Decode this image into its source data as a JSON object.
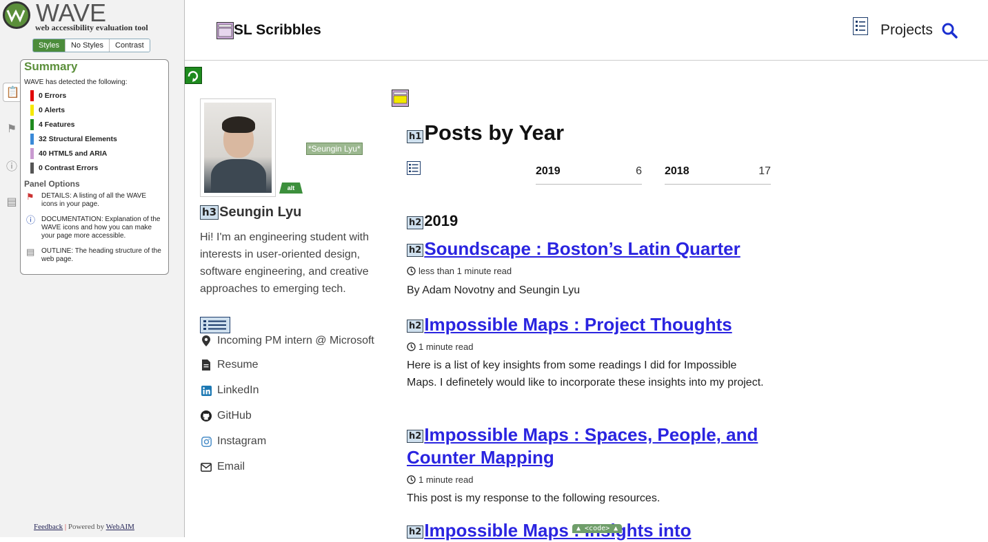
{
  "wave": {
    "title": "WAVE",
    "subtitle": "web accessibility evaluation tool",
    "modes": [
      "Styles",
      "No Styles",
      "Contrast"
    ],
    "summary_title": "Summary",
    "detected_text": "WAVE has detected the following:",
    "stats": [
      {
        "label": "0 Errors",
        "color": "#e00000"
      },
      {
        "label": "0 Alerts",
        "color": "#f5e800"
      },
      {
        "label": "4 Features",
        "color": "#1e8a1e"
      },
      {
        "label": "32 Structural Elements",
        "color": "#3a8ad8"
      },
      {
        "label": "40 HTML5 and ARIA",
        "color": "#c99ad0"
      },
      {
        "label": "0 Contrast Errors",
        "color": "#555555"
      }
    ],
    "panel_options_title": "Panel Options",
    "panel_options": [
      {
        "icon": "flag-icon",
        "text": "DETAILS: A listing of all the WAVE icons in your page."
      },
      {
        "icon": "info-icon",
        "text": "DOCUMENTATION: Explanation of the WAVE icons and how you can make your page more accessible."
      },
      {
        "icon": "document-icon",
        "text": "OUTLINE: The heading structure of the web page."
      }
    ],
    "footer_feedback": "Feedback",
    "footer_sep": "|",
    "footer_powered": "Powered by",
    "footer_webaim": "WebAIM"
  },
  "site": {
    "title": "SL Scribbles",
    "nav_projects": "Projects",
    "accent": "#2a24e0"
  },
  "author": {
    "alt_text": "*Seungin Lyu*",
    "alt_tag": "alt",
    "h3_badge": "h3",
    "name": "Seungin Lyu",
    "bio": "Hi! I'm an engineering student with interests in user-oriented design, software engineering, and creative approaches to emerging tech.",
    "links": [
      {
        "icon": "map-marker-icon",
        "label": "Incoming PM intern @ Microsoft"
      },
      {
        "icon": "file-icon",
        "label": "Resume"
      },
      {
        "icon": "linkedin-icon",
        "label": "LinkedIn"
      },
      {
        "icon": "github-icon",
        "label": "GitHub"
      },
      {
        "icon": "instagram-icon",
        "label": "Instagram"
      },
      {
        "icon": "envelope-icon",
        "label": "Email"
      }
    ]
  },
  "main": {
    "h1_badge": "h1",
    "h2_badge": "h2",
    "heading": "Posts by Year",
    "year_tabs": [
      {
        "year": "2019",
        "count": "6"
      },
      {
        "year": "2018",
        "count": "17"
      }
    ],
    "year_heading": "2019",
    "posts": [
      {
        "title": "Soundscape : Boston’s Latin Quarter",
        "meta": "less than 1 minute read",
        "excerpt": "By Adam Novotny and Seungin Lyu"
      },
      {
        "title": "Impossible Maps : Project Thoughts",
        "meta": "1 minute read",
        "excerpt": "Here is a list of key insights from some readings I did for Impossible Maps. I definetely would like to incorporate these insights into my project."
      },
      {
        "title": "Impossible Maps : Spaces, People, and Counter Mapping",
        "meta": "1 minute read",
        "excerpt": "This post is my response to the following resources."
      },
      {
        "title": "Impossible Maps : Insights into"
      }
    ],
    "code_badge": "▲ <code> ▲"
  }
}
